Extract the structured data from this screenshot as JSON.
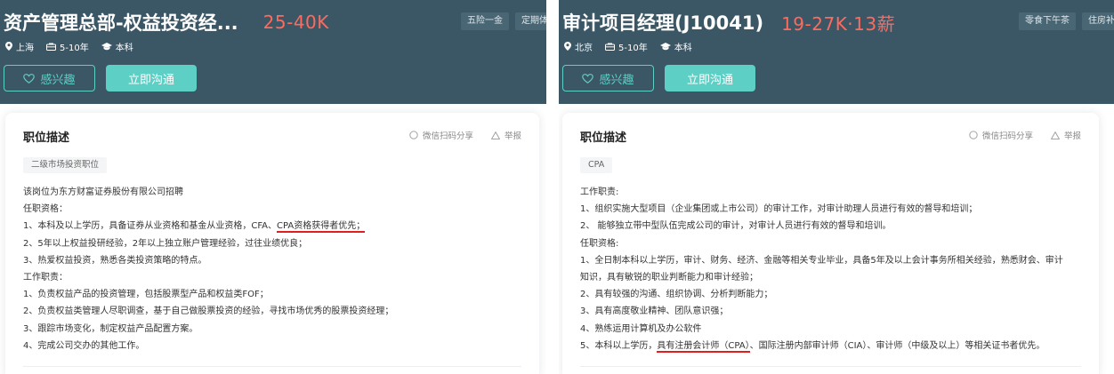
{
  "colors": {
    "header_bg": "#3b5766",
    "salary": "#fd6b5e",
    "accent": "#5dcfc5",
    "highlight_underline": "#e21f1f"
  },
  "left": {
    "title": "资产管理总部-权益投资经...",
    "salary": "25-40K",
    "benefits": [
      "五险一金",
      "定期体检"
    ],
    "meta": {
      "city": "上海",
      "experience": "5-10年",
      "education": "本科"
    },
    "buttons": {
      "interest": "感兴趣",
      "chat": "立即沟通"
    },
    "card": {
      "title": "职位描述",
      "share": "微信扫码分享",
      "report": "举报",
      "tag": "二级市场投资职位",
      "lines": [
        "该岗位为东方财富证券股份有限公司招聘",
        "任职资格：",
        "1、本科及以上学历，具备证券从业资格和基金从业资格，CFA、CPA资格获得者优先；",
        "2、5年以上权益投研经验，2年以上独立账户管理经验，过往业绩优良；",
        "3、热爱权益投资，熟悉各类投资策略的特点。",
        "工作职责：",
        "1、负责权益产品的投资管理，包括股票型产品和权益类FOF；",
        "2、负责权益类管理人尽职调查，基于自己做股票投资的经验，寻找市场优秀的股票投资经理；",
        "3、跟踪市场变化，制定权益产品配置方案。",
        "4、完成公司交办的其他工作。"
      ]
    }
  },
  "right": {
    "title": "审计项目经理(J10041)",
    "salary": "19-27K·13薪",
    "benefits": [
      "零食下午茶",
      "住房补贴"
    ],
    "meta": {
      "city": "北京",
      "experience": "5-10年",
      "education": "本科"
    },
    "buttons": {
      "interest": "感兴趣",
      "chat": "立即沟通"
    },
    "card": {
      "title": "职位描述",
      "share": "微信扫码分享",
      "report": "举报",
      "tag": "CPA",
      "lines": [
        "工作职责:",
        "1、组织实施大型项目（企业集团或上市公司）的审计工作，对审计助理人员进行有效的督导和培训；",
        "2、 能够独立带中型队伍完成公司的审计，对审计人员进行有效的督导和培训。",
        "任职资格:",
        "1、全日制本科以上学历，审计、财务、经济、金融等相关专业毕业，具备5年及以上会计事务所相关经验，熟悉财会、审计",
        "知识，具有敏锐的职业判断能力和审计经验；",
        "2、具有较强的沟通、组织协调、分析判断能力；",
        "3、具有高度敬业精神、团队意识强；",
        "4、熟练运用计算机及办公软件",
        "5、本科以上学历，具有注册会计师（CPA）、国际注册内部审计师（CIA）、审计师（中级及以上）等相关证书者优先。"
      ]
    }
  }
}
